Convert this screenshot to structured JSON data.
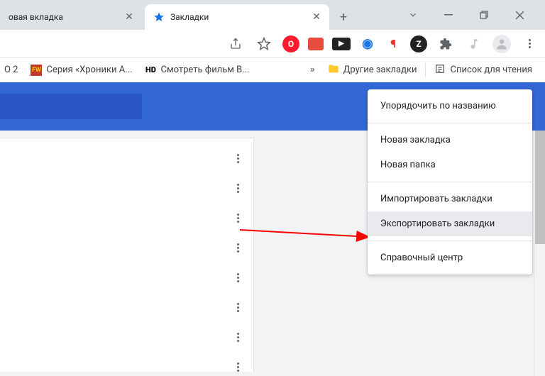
{
  "tabs": {
    "inactive": {
      "title": "овая вкладка"
    },
    "active": {
      "title": "Закладки"
    }
  },
  "bookmarkbar": {
    "items": [
      {
        "label": "О 2",
        "favicon_bg": "#e74c3c",
        "favicon_text": ""
      },
      {
        "label": "Серия «Хроники А...",
        "favicon_bg": "#c0392b",
        "favicon_text": "FW"
      },
      {
        "label": "Смотреть фильм В...",
        "favicon_bg": "#000",
        "favicon_text": "HD"
      }
    ],
    "overflow": "»",
    "other_bookmarks": "Другие закладки",
    "reading_list": "Список для чтения"
  },
  "extensions": [
    {
      "name": "opera-icon",
      "bg": "#ff1b2d",
      "text": "O",
      "color": "#fff"
    },
    {
      "name": "adblock-icon",
      "bg": "#e74c3c",
      "text": "",
      "color": "#fff"
    },
    {
      "name": "video-icon",
      "bg": "#222",
      "text": "▸",
      "color": "#fff"
    },
    {
      "name": "globe-icon",
      "bg": "#fff",
      "text": "◉",
      "color": "#1a73e8"
    },
    {
      "name": "thumbsdown-icon",
      "bg": "#fff",
      "text": "👎",
      "color": "#e53935"
    },
    {
      "name": "zenmate-icon",
      "bg": "#222",
      "text": "Z",
      "color": "#fff"
    }
  ],
  "context_menu": {
    "sort_by_name": "Упорядочить по названию",
    "new_bookmark": "Новая закладка",
    "new_folder": "Новая папка",
    "import_bookmarks": "Импортировать закладки",
    "export_bookmarks": "Экспортировать закладки",
    "help_center": "Справочный центр"
  }
}
